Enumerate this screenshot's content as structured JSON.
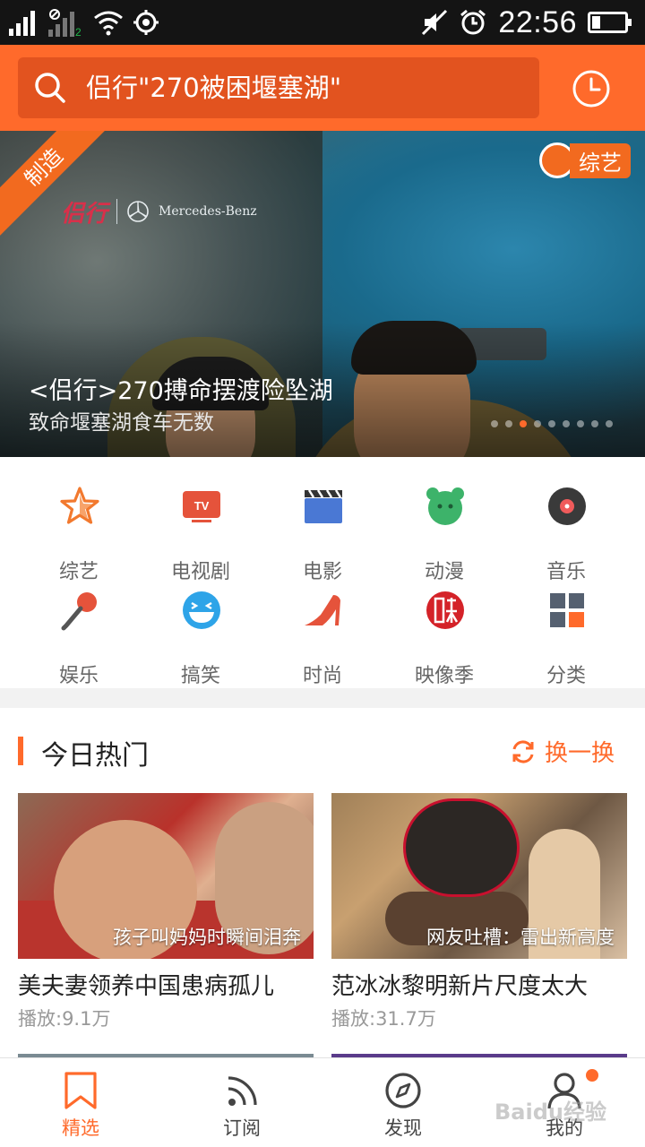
{
  "status_bar": {
    "time": "22:56",
    "sim2_label": "2"
  },
  "search": {
    "query": "侣行\"270被困堰塞湖\""
  },
  "banner": {
    "ribbon": "制造",
    "brand_left": "侣行",
    "brand_partner": "Mercedes-Benz",
    "tag": "综艺",
    "title": "<侣行>270搏命摆渡险坠湖",
    "subtitle": "致命堰塞湖食车无数",
    "slide_count": 9,
    "active_slide": 3
  },
  "categories": [
    {
      "label": "综艺",
      "icon": "star-icon"
    },
    {
      "label": "电视剧",
      "icon": "tv-icon"
    },
    {
      "label": "电影",
      "icon": "clapperboard-icon"
    },
    {
      "label": "动漫",
      "icon": "cartoon-face-icon"
    },
    {
      "label": "音乐",
      "icon": "vinyl-record-icon"
    },
    {
      "label": "娱乐",
      "icon": "microphone-icon"
    },
    {
      "label": "搞笑",
      "icon": "laughing-face-icon"
    },
    {
      "label": "时尚",
      "icon": "high-heel-icon"
    },
    {
      "label": "映像季",
      "icon": "ying-logo-icon"
    },
    {
      "label": "分类",
      "icon": "grid-icon"
    }
  ],
  "hot": {
    "title": "今日热门",
    "refresh_label": "换一换",
    "cards": [
      {
        "caption": "孩子叫妈妈时瞬间泪奔",
        "title": "美夫妻领养中国患病孤儿",
        "plays": "播放:9.1万"
      },
      {
        "caption": "网友吐槽：雷出新高度",
        "title": "范冰冰黎明新片尺度太大",
        "plays": "播放:31.7万"
      }
    ]
  },
  "bottom_nav": [
    {
      "label": "精选",
      "icon": "bookmark-icon",
      "active": true
    },
    {
      "label": "订阅",
      "icon": "rss-icon",
      "active": false
    },
    {
      "label": "发现",
      "icon": "compass-icon",
      "active": false
    },
    {
      "label": "我的",
      "icon": "user-icon",
      "active": false
    }
  ],
  "watermark": "Baidu经验",
  "colors": {
    "brand_orange": "#ff6a2b",
    "search_bg": "#e2531f",
    "status_bar": "#141414"
  }
}
